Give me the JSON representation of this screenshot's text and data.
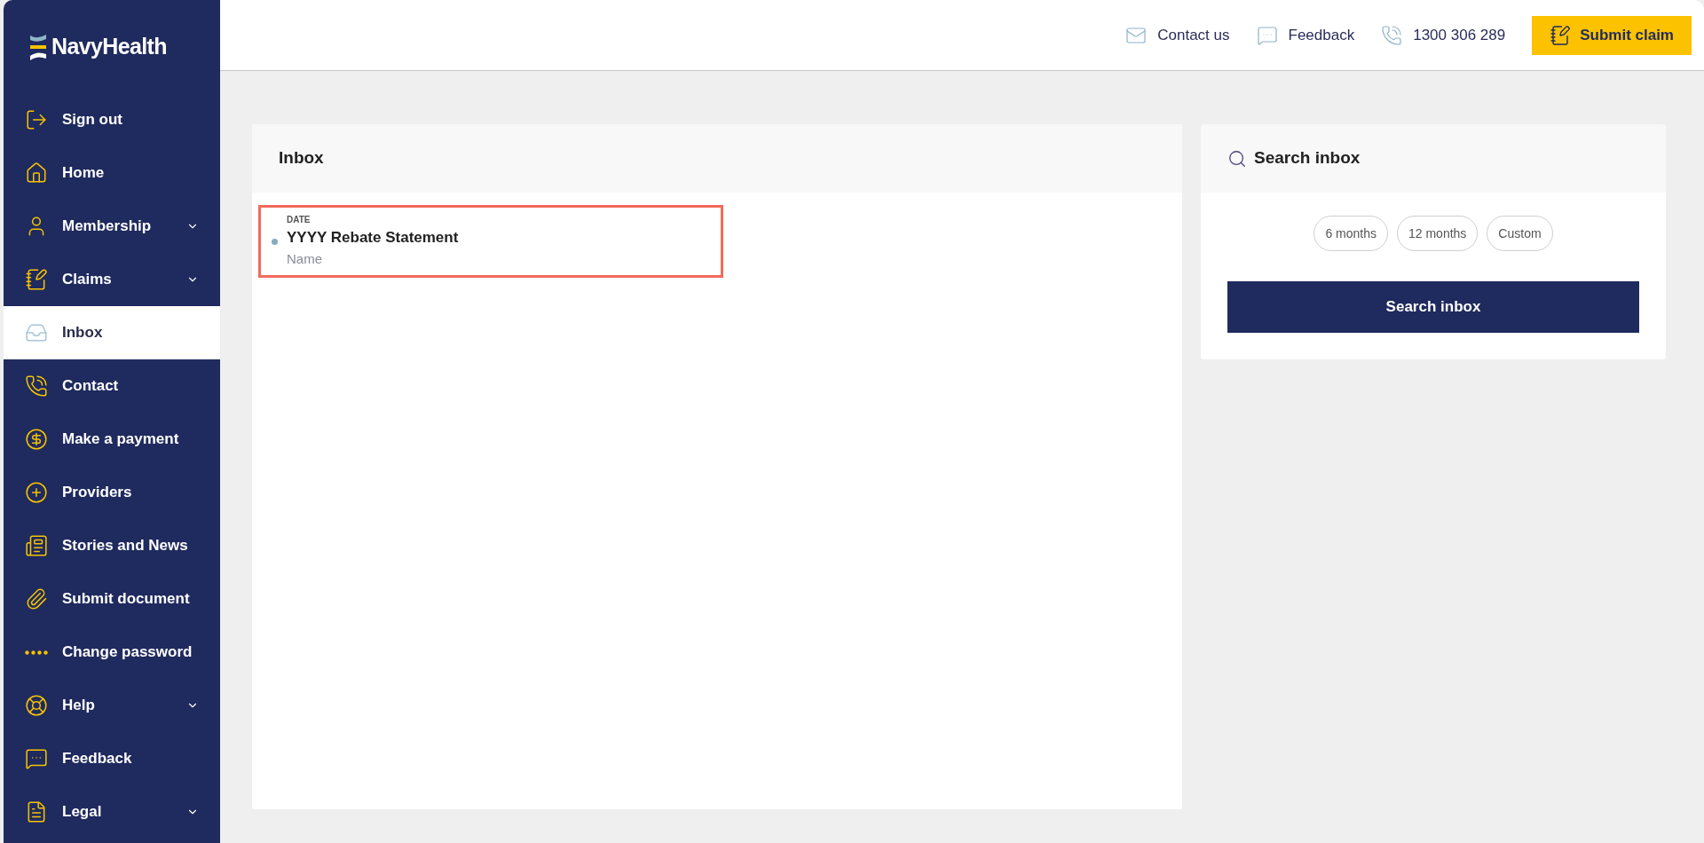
{
  "logo": {
    "text": "NavyHealth"
  },
  "sidebar": {
    "items": [
      {
        "label": "Sign out",
        "selected": false,
        "expandable": false
      },
      {
        "label": "Home",
        "selected": false,
        "expandable": false
      },
      {
        "label": "Membership",
        "selected": false,
        "expandable": true
      },
      {
        "label": "Claims",
        "selected": false,
        "expandable": true
      },
      {
        "label": "Inbox",
        "selected": true,
        "expandable": false
      },
      {
        "label": "Contact",
        "selected": false,
        "expandable": false
      },
      {
        "label": "Make a payment",
        "selected": false,
        "expandable": false
      },
      {
        "label": "Providers",
        "selected": false,
        "expandable": false
      },
      {
        "label": "Stories and News",
        "selected": false,
        "expandable": false
      },
      {
        "label": "Submit document",
        "selected": false,
        "expandable": false
      },
      {
        "label": "Change password",
        "selected": false,
        "expandable": false
      },
      {
        "label": "Help",
        "selected": false,
        "expandable": true
      },
      {
        "label": "Feedback",
        "selected": false,
        "expandable": false
      },
      {
        "label": "Legal",
        "selected": false,
        "expandable": true
      }
    ]
  },
  "header": {
    "links": [
      "Contact us",
      "Feedback",
      "1300 306 289"
    ],
    "cta": "Submit claim"
  },
  "inbox": {
    "title": "Inbox",
    "messages": [
      {
        "date": "DATE",
        "title": "YYYY Rebate Statement",
        "name": "Name",
        "unread": true,
        "highlighted": true
      }
    ]
  },
  "search": {
    "title": "Search inbox",
    "ranges": [
      {
        "label": "6 months",
        "selected": false
      },
      {
        "label": "12 months",
        "selected": false
      },
      {
        "label": "Custom",
        "selected": false
      }
    ],
    "button": "Search inbox"
  }
}
